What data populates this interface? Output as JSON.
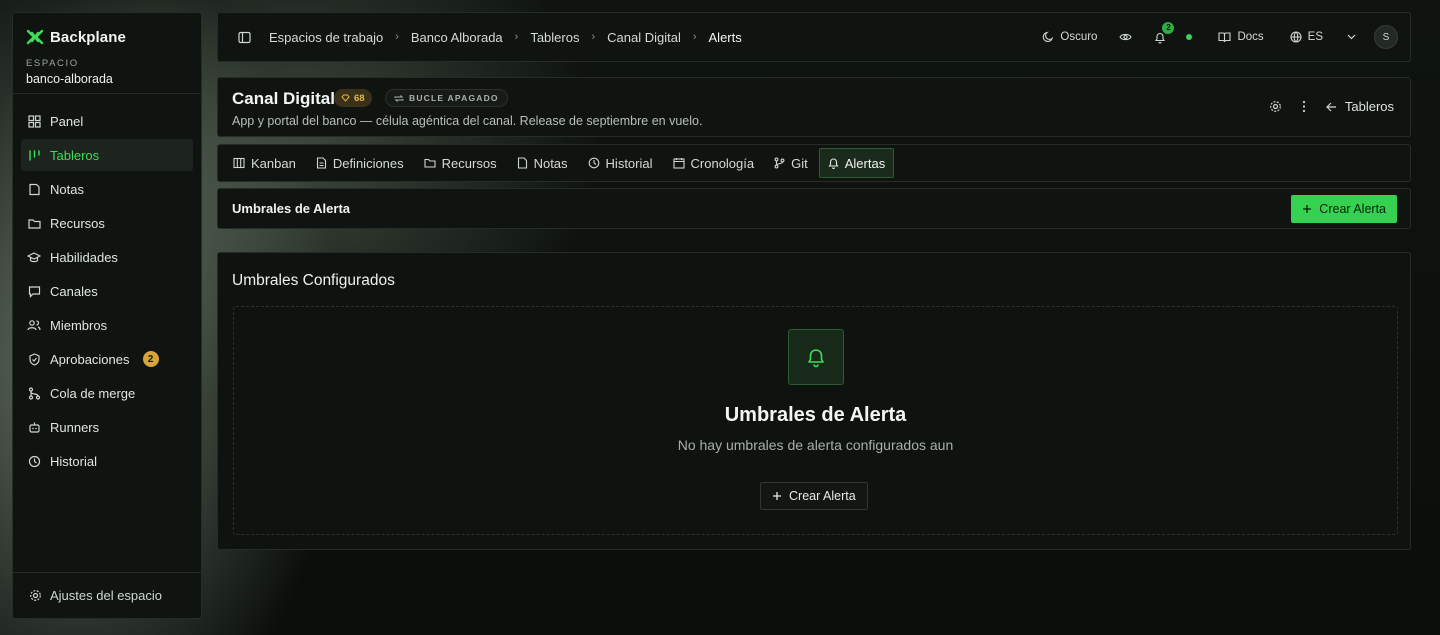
{
  "brand": {
    "name": "Backplane"
  },
  "workspace": {
    "label": "ESPACIO",
    "name": "banco-alborada"
  },
  "sidebar": {
    "items": [
      {
        "label": "Panel",
        "icon": "grid-icon"
      },
      {
        "label": "Tableros",
        "icon": "columns-icon",
        "active": true
      },
      {
        "label": "Notas",
        "icon": "note-icon"
      },
      {
        "label": "Recursos",
        "icon": "folder-icon"
      },
      {
        "label": "Habilidades",
        "icon": "graduation-icon"
      },
      {
        "label": "Canales",
        "icon": "chat-icon"
      },
      {
        "label": "Miembros",
        "icon": "users-icon"
      },
      {
        "label": "Aprobaciones",
        "icon": "shield-icon",
        "badge": "2"
      },
      {
        "label": "Cola de merge",
        "icon": "merge-icon"
      },
      {
        "label": "Runners",
        "icon": "bot-icon"
      },
      {
        "label": "Historial",
        "icon": "clock-icon"
      }
    ],
    "footer_label": "Ajustes del espacio"
  },
  "breadcrumbs": [
    "Espacios de trabajo",
    "Banco Alborada",
    "Tableros",
    "Canal Digital",
    "Alerts"
  ],
  "topbar": {
    "theme_label": "Oscuro",
    "notifications_count": "2",
    "docs_label": "Docs",
    "language": "ES",
    "avatar_initial": "S"
  },
  "board": {
    "title": "Canal Digital",
    "score": "68",
    "loop_status": "BUCLE APAGADO",
    "description": "App y portal del banco — célula agéntica del canal. Release de septiembre en vuelo.",
    "back_label": "Tableros"
  },
  "tabs": [
    {
      "label": "Kanban",
      "icon": "kanban-icon"
    },
    {
      "label": "Definiciones",
      "icon": "document-icon"
    },
    {
      "label": "Recursos",
      "icon": "folder-icon"
    },
    {
      "label": "Notas",
      "icon": "note-icon"
    },
    {
      "label": "Historial",
      "icon": "clock-icon"
    },
    {
      "label": "Cronología",
      "icon": "calendar-icon"
    },
    {
      "label": "Git",
      "icon": "git-branch-icon"
    },
    {
      "label": "Alertas",
      "icon": "bell-icon",
      "active": true
    }
  ],
  "section": {
    "title": "Umbrales de Alerta",
    "create_label": "Crear Alerta"
  },
  "panel": {
    "title": "Umbrales Configurados",
    "empty_title": "Umbrales de Alerta",
    "empty_subtitle": "No hay umbrales de alerta configurados aun",
    "empty_button_label": "Crear Alerta"
  },
  "colors": {
    "accent": "#35d150",
    "background": "#0b0f0b",
    "panel": "#101410",
    "badge": "#d7a43a"
  }
}
